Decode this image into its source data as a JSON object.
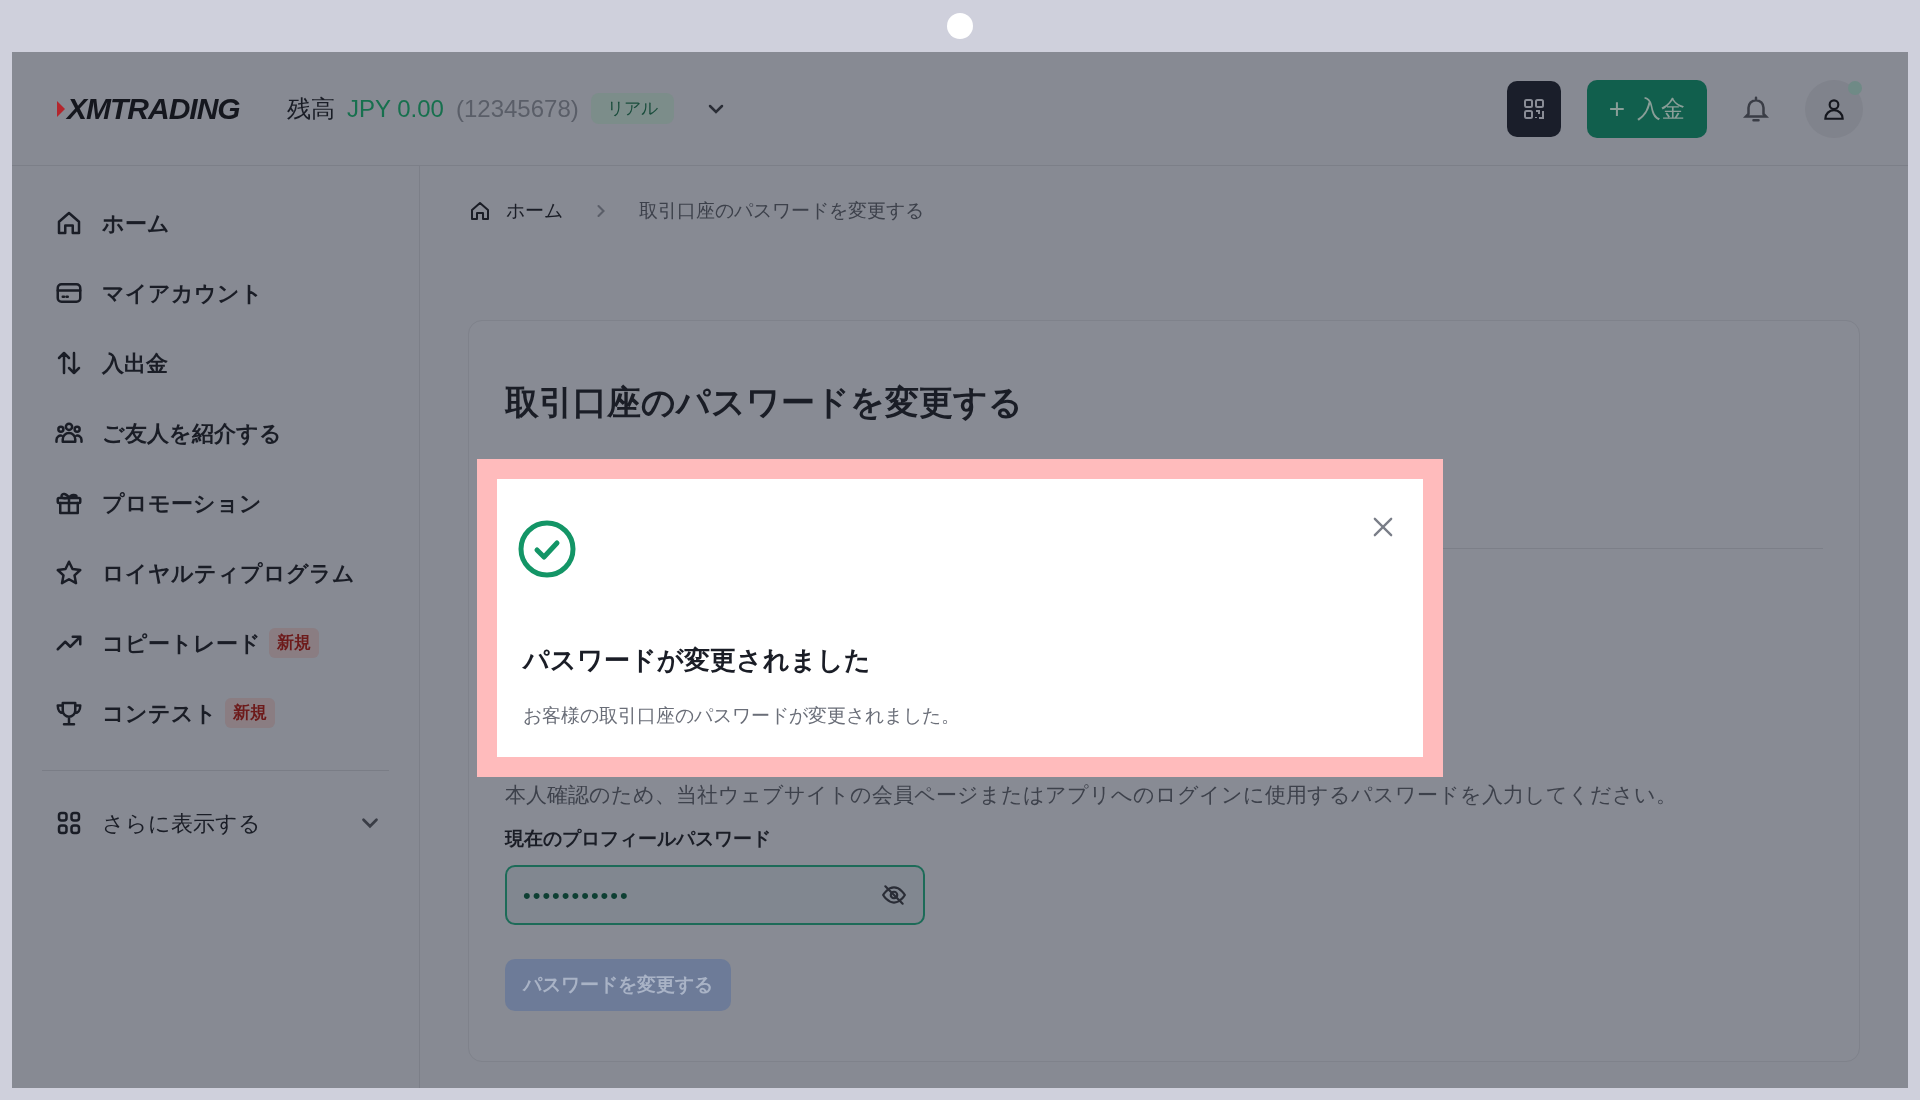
{
  "header": {
    "logo": "XMTRADING",
    "balance_label": "残高",
    "balance": "JPY 0.00",
    "account": "(12345678)",
    "account_badge": "リアル",
    "deposit_button": {
      "icon": "+",
      "label": "入金"
    }
  },
  "sidebar": {
    "items": [
      {
        "label": "ホーム"
      },
      {
        "label": "マイアカウント"
      },
      {
        "label": "入出金"
      },
      {
        "label": "ご友人を紹介する"
      },
      {
        "label": "プロモーション"
      },
      {
        "label": "ロイヤルティプログラム"
      },
      {
        "label": "コピートレード",
        "badge": "新規"
      },
      {
        "label": "コンテスト",
        "badge": "新規"
      }
    ],
    "more": {
      "label": "さらに表示する",
      "expanded": false
    }
  },
  "breadcrumb": [
    "ホーム",
    "取引口座のパスワードを変更する"
  ],
  "page": {
    "title": "取引口座のパスワードを変更する",
    "instruction": "本人確認のため、当社ウェブサイトの会員ページまたはアプリへのログインに使用するパスワードを入力してください。",
    "field": {
      "label": "現在のプロフィールパスワード",
      "value": "•••••••••••"
    },
    "submit": {
      "label": "パスワードを変更する",
      "disabled": true
    }
  },
  "dialog": {
    "title": "パスワードが変更されました",
    "message": "お客様の取引口座のパスワードが変更されました。"
  }
}
